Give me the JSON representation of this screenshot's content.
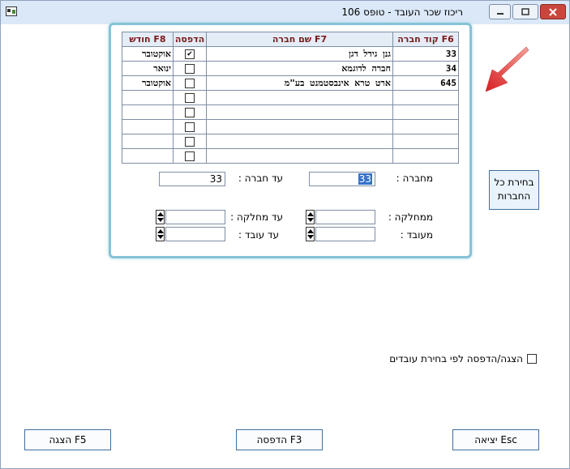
{
  "window": {
    "title": "ריכוז שכר העובד - טופס 106"
  },
  "grid": {
    "headers": {
      "code": "קוד חברה F6",
      "name": "שם חברה F7",
      "print": "הדפסה",
      "month": "חודש F8"
    },
    "rows": [
      {
        "code": "33",
        "name": "גנן גידל דגן",
        "print": true,
        "month": "אוקטובר"
      },
      {
        "code": "34",
        "name": "חברה לדוגמא",
        "print": false,
        "month": "ינואר"
      },
      {
        "code": "645",
        "name": "ארט טרא אינבסטמנט בע\"מ",
        "print": false,
        "month": "אוקטובר"
      },
      {
        "code": "",
        "name": "",
        "print": false,
        "month": ""
      },
      {
        "code": "",
        "name": "",
        "print": false,
        "month": ""
      },
      {
        "code": "",
        "name": "",
        "print": false,
        "month": ""
      },
      {
        "code": "",
        "name": "",
        "print": false,
        "month": ""
      },
      {
        "code": "",
        "name": "",
        "print": false,
        "month": ""
      }
    ]
  },
  "filters": {
    "from_company_label": "מחברה :",
    "from_company_value": "33",
    "to_company_label": "עד חברה :",
    "to_company_value": "33",
    "from_dept_label": "ממחלקה :",
    "from_dept_value": "",
    "to_dept_label": "עד מחלקה :",
    "to_dept_value": "",
    "from_employee_label": "מעובד :",
    "from_employee_value": "",
    "to_employee_label": "עד עובד :",
    "to_employee_value": ""
  },
  "select_all": {
    "line1": "בחירת כל",
    "line2": "החברות"
  },
  "option": {
    "label": "הצגה/הדפסה לפי בחירת עובדים",
    "checked": false
  },
  "buttons": {
    "exit": "יציאה Esc",
    "print": "הדפסה F3",
    "show": "הצגה F5"
  },
  "colors": {
    "arrow": "#e3262a",
    "panel_border": "#86c3d8",
    "header_text": "#7a1a1a"
  }
}
